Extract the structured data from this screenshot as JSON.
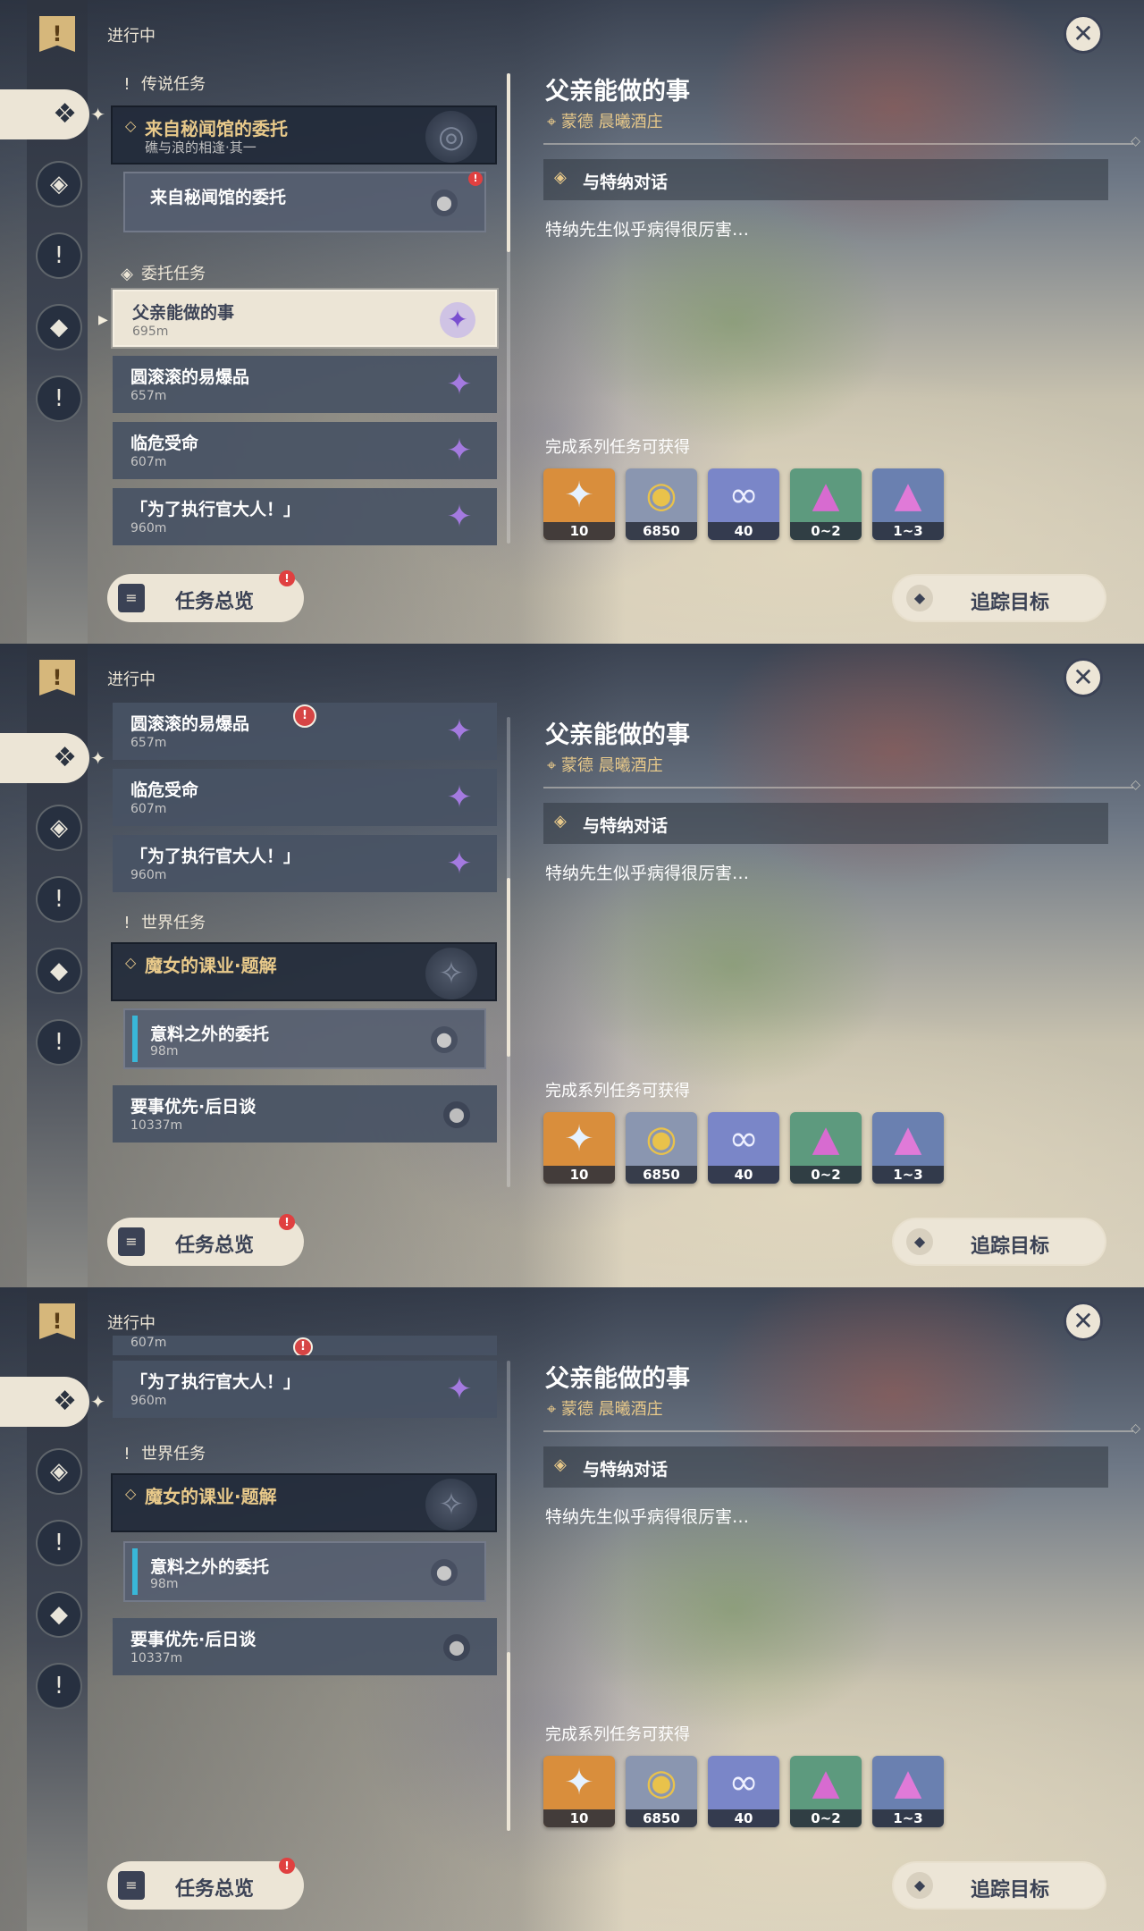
{
  "sidebar": {
    "top_icon": "quest-book-icon",
    "active_icon": "commission-icon",
    "buttons": [
      {
        "name": "archon-quest-icon",
        "glyph": "◈"
      },
      {
        "name": "story-quest-icon",
        "glyph": "!"
      },
      {
        "name": "commission-quest-icon",
        "glyph": "◆"
      },
      {
        "name": "world-quest-icon",
        "glyph": "!"
      }
    ]
  },
  "list": {
    "in_progress": "进行中",
    "overview_label": "任务总览",
    "legend_section": "传说任务",
    "commission_section": "委托任务",
    "world_section": "世界任务",
    "legend_series": {
      "title": "来自秘闻馆的委托",
      "subtitle": "礁与浪的相逢·其一"
    },
    "legend_sub": {
      "title": "来自秘闻馆的委托"
    },
    "commissions": [
      {
        "title": "父亲能做的事",
        "meters": "695m"
      },
      {
        "title": "圆滚滚的易爆品",
        "meters": "657m"
      },
      {
        "title": "临危受命",
        "meters": "607m"
      },
      {
        "title": "「为了执行官大人！」",
        "meters": "960m"
      }
    ],
    "world_series": {
      "title": "魔女的课业·题解"
    },
    "world_sub": {
      "title": "意料之外的委托",
      "meters": "98m"
    },
    "world_other": {
      "title": "要事优先·后日谈",
      "meters": "10337m"
    },
    "partial_meters": "607m"
  },
  "detail": {
    "title": "父亲能做的事",
    "location": "蒙德 晨曦酒庄",
    "step": "与特纳对话",
    "description": "特纳先生似乎病得很厉害…",
    "reward_header": "完成系列任务可获得",
    "rewards": [
      {
        "name": "primogem-icon",
        "count": "10",
        "glyph": "✦",
        "bg": "#d98e3c",
        "fg": "#e6f2ff"
      },
      {
        "name": "mora-icon",
        "count": "6850",
        "glyph": "◉",
        "bg": "#8a96b0",
        "fg": "#e9c24b"
      },
      {
        "name": "adventure-exp-icon",
        "count": "40",
        "glyph": "∞",
        "bg": "#7a86c8",
        "fg": "#eef0ff"
      },
      {
        "name": "crystal-chunk-icon",
        "count": "0~2",
        "glyph": "▲",
        "bg": "#5d9a7e",
        "fg": "#d76bd0"
      },
      {
        "name": "crystal-cluster-icon",
        "count": "1~3",
        "glyph": "▲",
        "bg": "#6a80b0",
        "fg": "#e07ad8"
      }
    ],
    "track_label": "追踪目标"
  },
  "colors": {
    "accent_gold": "#e8c98a",
    "panel_cream": "#ece5d6",
    "warning_red": "#e04040",
    "nav_blue": "#39b7d8"
  }
}
